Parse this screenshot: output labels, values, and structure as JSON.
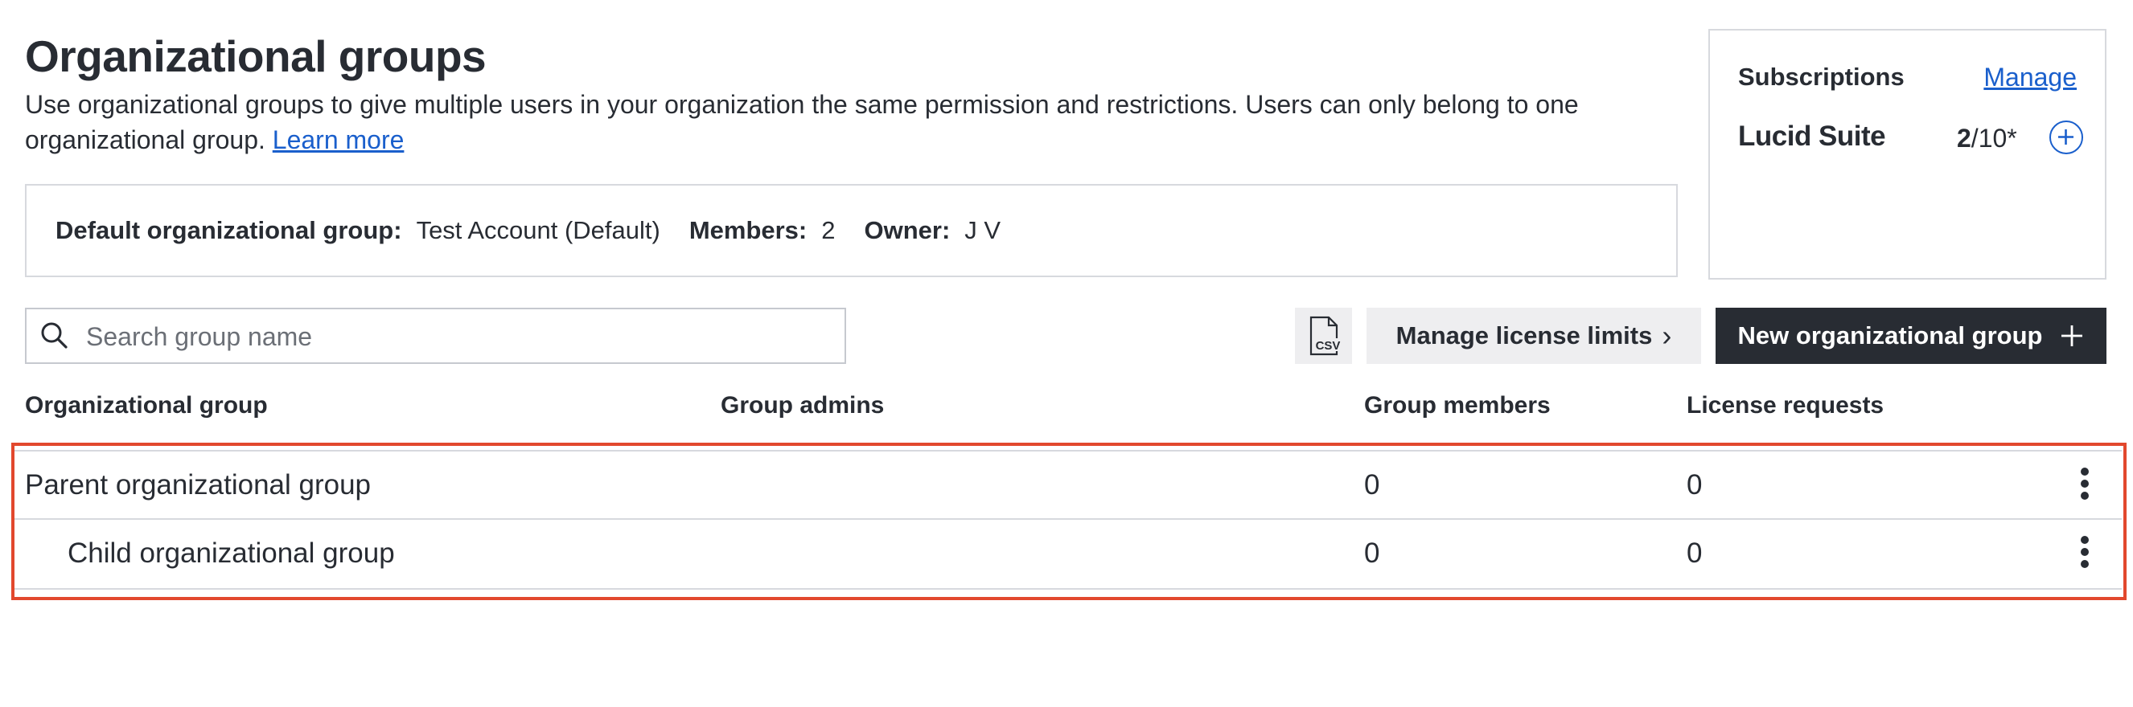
{
  "header": {
    "title": "Organizational groups",
    "description": "Use organizational groups to give multiple users in your organization the same permission and restrictions. Users can only belong to one organizational group.",
    "learn_more": "Learn more"
  },
  "default_group": {
    "label": "Default organizational group:",
    "value": "Test Account (Default)",
    "members_label": "Members:",
    "members_value": "2",
    "owner_label": "Owner:",
    "owner_value": "J V"
  },
  "subscriptions": {
    "title": "Subscriptions",
    "manage": "Manage",
    "product": "Lucid Suite",
    "used": "2",
    "total": "/10*",
    "add_icon": "plus-circle-icon"
  },
  "search": {
    "placeholder": "Search group name",
    "icon": "search-icon"
  },
  "toolbar": {
    "csv_icon": "csv-file-icon",
    "csv_text": "CSV",
    "manage_limits": "Manage license limits",
    "manage_limits_chevron": "›",
    "new_group": "New organizational group",
    "new_group_icon": "plus-icon"
  },
  "table": {
    "columns": [
      "Organizational group",
      "Group admins",
      "Group members",
      "License requests"
    ],
    "rows": [
      {
        "name": "Parent organizational group",
        "admins": "",
        "members": "0",
        "requests": "0"
      },
      {
        "name": "Child organizational group",
        "admins": "",
        "members": "0",
        "requests": "0"
      }
    ]
  },
  "colors": {
    "text": "#282c33",
    "link": "#1a5fcc",
    "primary_button": "#282c33",
    "secondary_button": "#eeeef0",
    "border": "#d7d9de",
    "highlight": "#e2482d"
  }
}
